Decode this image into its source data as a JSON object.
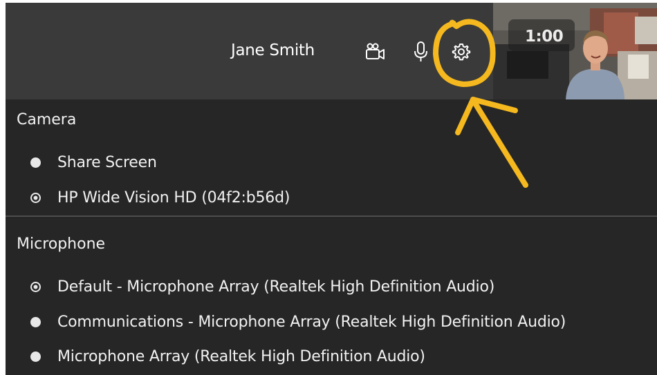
{
  "header": {
    "user_name": "Jane Smith",
    "timer": "1:00"
  },
  "icons": {
    "camera": "video-camera-icon",
    "microphone": "microphone-icon",
    "settings": "gear-icon"
  },
  "camera_section": {
    "title": "Camera",
    "options": [
      {
        "label": "Share Screen",
        "selected": false
      },
      {
        "label": "HP Wide Vision HD (04f2:b56d)",
        "selected": true
      }
    ]
  },
  "microphone_section": {
    "title": "Microphone",
    "options": [
      {
        "label": "Default - Microphone Array (Realtek High Definition Audio)",
        "selected": true
      },
      {
        "label": "Communications - Microphone Array (Realtek High Definition Audio)",
        "selected": false
      },
      {
        "label": "Microphone Array (Realtek High Definition Audio)",
        "selected": false
      }
    ]
  },
  "colors": {
    "panel_bg": "#262626",
    "topbar_bg": "#3a3a3a",
    "text": "#f2f2f2",
    "annotation": "#f5b81e"
  }
}
